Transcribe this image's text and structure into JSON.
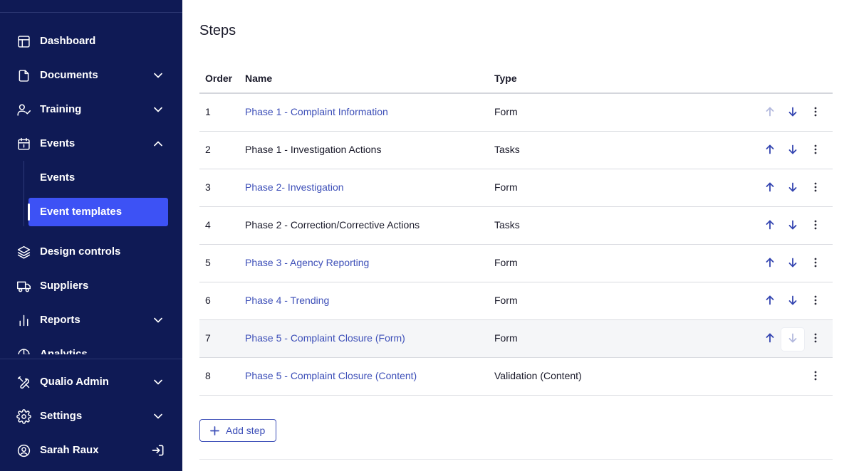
{
  "sidebar": {
    "items": [
      {
        "label": "Dashboard",
        "icon": "layout-icon"
      },
      {
        "label": "Documents",
        "icon": "document-icon",
        "expanded": false
      },
      {
        "label": "Training",
        "icon": "user-check-icon",
        "expanded": false
      },
      {
        "label": "Events",
        "icon": "calendar-icon",
        "expanded": true
      },
      {
        "label": "Design controls",
        "icon": "layers-icon"
      },
      {
        "label": "Suppliers",
        "icon": "truck-icon"
      },
      {
        "label": "Reports",
        "icon": "bar-chart-icon",
        "expanded": false
      },
      {
        "label": "Analytics",
        "icon": "pie-chart-icon"
      }
    ],
    "events_sub": [
      {
        "label": "Events",
        "active": false
      },
      {
        "label": "Event templates",
        "active": true
      }
    ],
    "bottom": [
      {
        "label": "Qualio Admin",
        "icon": "tools-icon",
        "expanded": false
      },
      {
        "label": "Settings",
        "icon": "gear-icon",
        "expanded": false
      },
      {
        "label": "Sarah Raux",
        "icon": "user-circle-icon",
        "action_icon": "logout-icon"
      }
    ]
  },
  "main": {
    "title": "Steps",
    "columns": {
      "order": "Order",
      "name": "Name",
      "type": "Type"
    },
    "rows": [
      {
        "order": "1",
        "name": "Phase 1 - Complaint Information",
        "type": "Form",
        "link": true,
        "up_disabled": true,
        "down_disabled": false,
        "show_arrows": true
      },
      {
        "order": "2",
        "name": "Phase 1 - Investigation Actions",
        "type": "Tasks",
        "link": false,
        "up_disabled": false,
        "down_disabled": false,
        "show_arrows": true
      },
      {
        "order": "3",
        "name": "Phase 2- Investigation",
        "type": "Form",
        "link": true,
        "up_disabled": false,
        "down_disabled": false,
        "show_arrows": true
      },
      {
        "order": "4",
        "name": "Phase 2 - Correction/Corrective Actions",
        "type": "Tasks",
        "link": false,
        "up_disabled": false,
        "down_disabled": false,
        "show_arrows": true
      },
      {
        "order": "5",
        "name": "Phase 3 - Agency Reporting",
        "type": "Form",
        "link": true,
        "up_disabled": false,
        "down_disabled": false,
        "show_arrows": true
      },
      {
        "order": "6",
        "name": "Phase 4 - Trending",
        "type": "Form",
        "link": true,
        "up_disabled": false,
        "down_disabled": false,
        "show_arrows": true
      },
      {
        "order": "7",
        "name": "Phase 5 - Complaint Closure (Form)",
        "type": "Form",
        "link": true,
        "up_disabled": false,
        "down_disabled": true,
        "show_arrows": true,
        "hover": true
      },
      {
        "order": "8",
        "name": "Phase 5 - Complaint Closure (Content)",
        "type": "Validation (Content)",
        "link": true,
        "up_disabled": false,
        "down_disabled": false,
        "show_arrows": false
      }
    ],
    "add_step_label": "Add step"
  },
  "colors": {
    "sidebar_bg": "#0f1a55",
    "active_item": "#3d52f5",
    "link": "#3d4fb8",
    "icon_blue": "#3344b0"
  }
}
